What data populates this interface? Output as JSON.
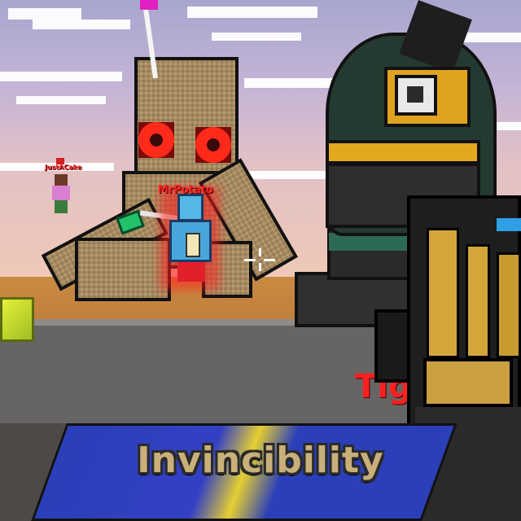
{
  "hud": {
    "buff_label": "Invincibility"
  },
  "players": {
    "near_name": "MrPotato",
    "far_name": "JustACake",
    "right_name": "Tig"
  },
  "colors": {
    "name_tag": "#ff2020",
    "buff_text": "#c9b07a",
    "weapon_gold": "#d4a63a",
    "weapon_black": "#1a1a1a",
    "weapon_blue": "#2f6fd6"
  },
  "icons": {
    "crosshair": "crosshair-icon"
  }
}
